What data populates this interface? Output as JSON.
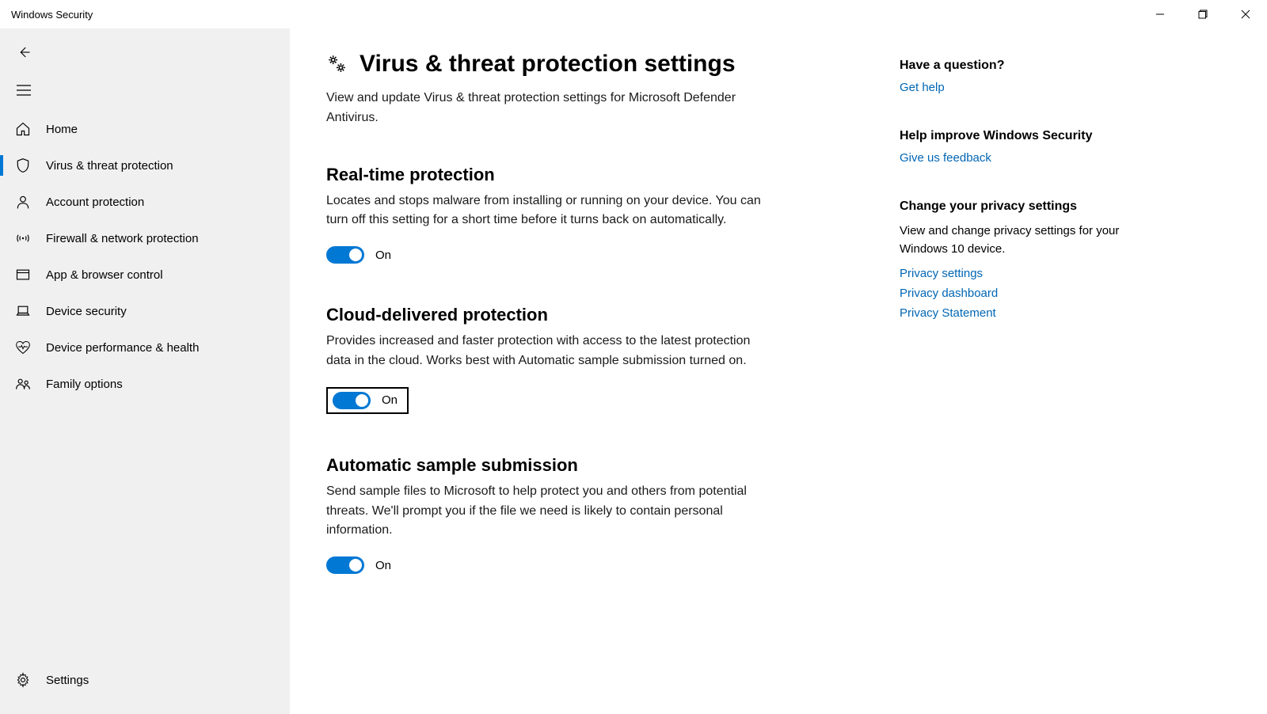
{
  "window": {
    "title": "Windows Security"
  },
  "sidebar": {
    "items": [
      {
        "label": "Home"
      },
      {
        "label": "Virus & threat protection"
      },
      {
        "label": "Account protection"
      },
      {
        "label": "Firewall & network protection"
      },
      {
        "label": "App & browser control"
      },
      {
        "label": "Device security"
      },
      {
        "label": "Device performance & health"
      },
      {
        "label": "Family options"
      }
    ],
    "settings_label": "Settings"
  },
  "page": {
    "title": "Virus & threat protection settings",
    "subtitle": "View and update Virus & threat protection settings for Microsoft Defender Antivirus."
  },
  "sections": {
    "realtime": {
      "title": "Real-time protection",
      "desc": "Locates and stops malware from installing or running on your device. You can turn off this setting for a short time before it turns back on automatically.",
      "state": "On"
    },
    "cloud": {
      "title": "Cloud-delivered protection",
      "desc": "Provides increased and faster protection with access to the latest protection data in the cloud. Works best with Automatic sample submission turned on.",
      "state": "On"
    },
    "sample": {
      "title": "Automatic sample submission",
      "desc": "Send sample files to Microsoft to help protect you and others from potential threats. We'll prompt you if the file we need is likely to contain personal information.",
      "state": "On"
    }
  },
  "aside": {
    "question": {
      "title": "Have a question?",
      "link": "Get help"
    },
    "improve": {
      "title": "Help improve Windows Security",
      "link": "Give us feedback"
    },
    "privacy": {
      "title": "Change your privacy settings",
      "desc": "View and change privacy settings for your Windows 10 device.",
      "links": [
        "Privacy settings",
        "Privacy dashboard",
        "Privacy Statement"
      ]
    }
  }
}
